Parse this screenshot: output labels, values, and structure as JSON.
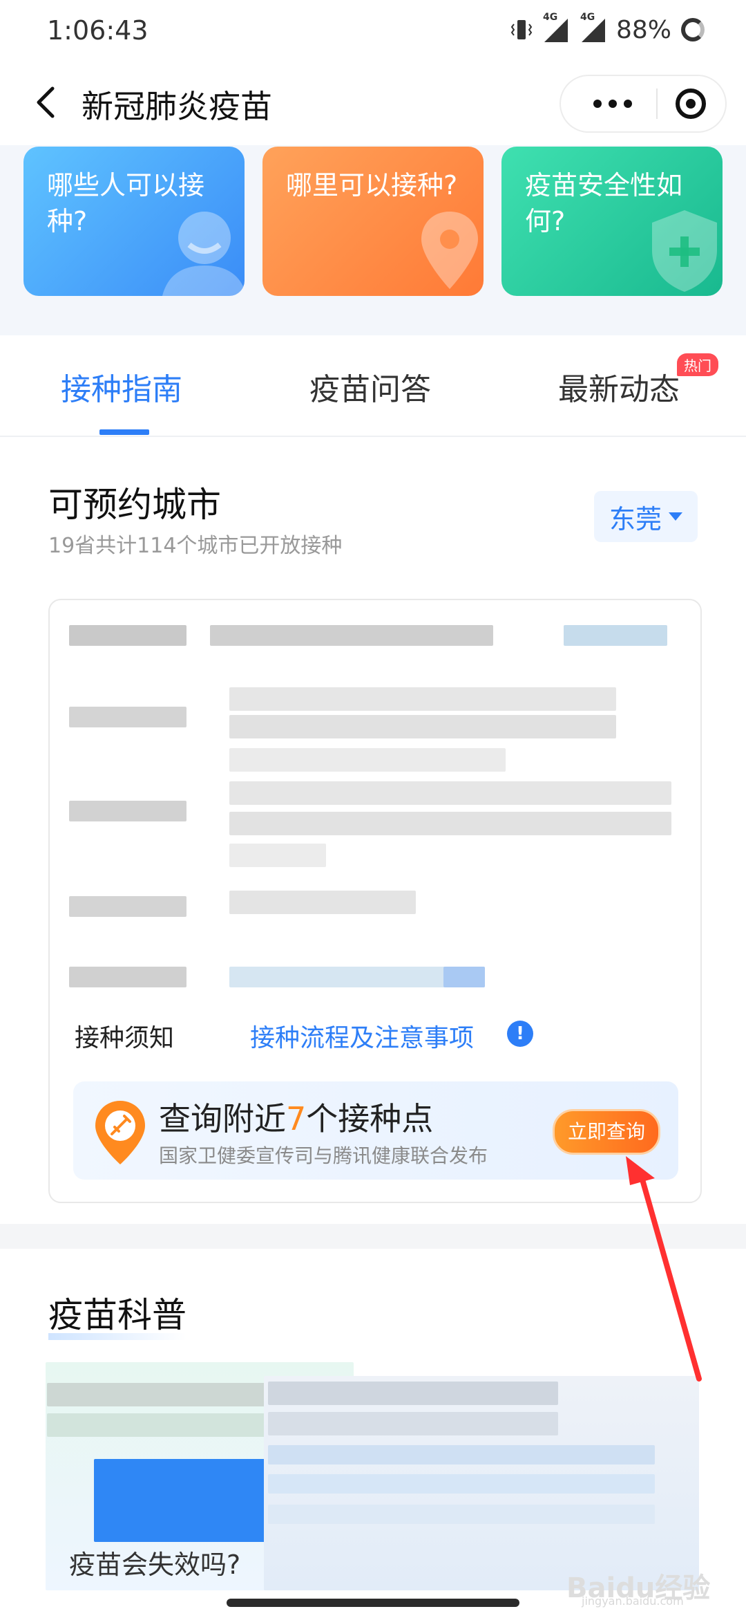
{
  "status_bar": {
    "time": "1:06:43",
    "net1": "4G",
    "net2": "4G",
    "battery": "88%"
  },
  "nav": {
    "title": "新冠肺炎疫苗"
  },
  "cards": [
    {
      "label": "哪些人可以接种?",
      "icon": "person-icon",
      "color": "#3a8cf7"
    },
    {
      "label": "哪里可以接种?",
      "icon": "location-pin-icon",
      "color": "#ff7a36"
    },
    {
      "label": "疫苗安全性如何?",
      "icon": "shield-plus-icon",
      "color": "#19b98f"
    }
  ],
  "tabs": [
    {
      "label": "接种指南",
      "active": true
    },
    {
      "label": "疫苗问答",
      "active": false
    },
    {
      "label": "最新动态",
      "active": false,
      "badge": "热门"
    }
  ],
  "cities": {
    "title": "可预约城市",
    "subtitle": "19省共计114个城市已开放接种",
    "selected_city": "东莞"
  },
  "notice": {
    "label": "接种须知",
    "link": "接种流程及注意事项"
  },
  "query": {
    "prefix": "查询附近",
    "count": "7",
    "suffix": "个接种点",
    "source": "国家卫健委宣传司与腾讯健康联合发布",
    "button": "立即查询"
  },
  "science": {
    "title": "疫苗科普",
    "caption": "疫苗会失效吗?"
  },
  "watermark": {
    "text": "Baidu经验",
    "url": "jingyan.baidu.com"
  },
  "colors": {
    "accent": "#2d7ef7",
    "orange": "#ff8a1f",
    "annotation_arrow": "#ff3030"
  }
}
